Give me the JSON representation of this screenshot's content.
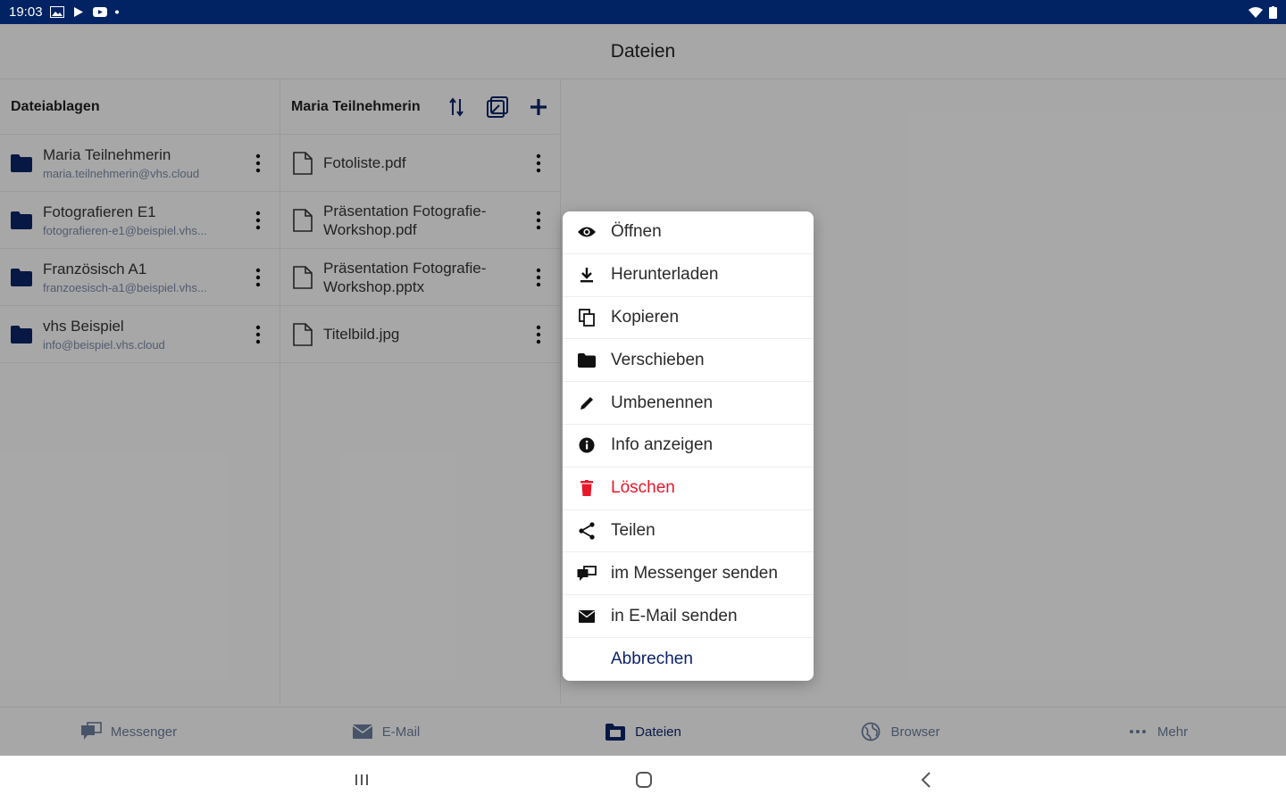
{
  "status_bar": {
    "time": "19:03"
  },
  "app": {
    "title": "Dateien",
    "colors": {
      "navy": "#0d2468",
      "danger": "#e8172a",
      "statusbar": "#012363"
    }
  },
  "stores": {
    "header": "Dateiablagen",
    "items": [
      {
        "name": "Maria Teilnehmerin",
        "email": "maria.teilnehmerin@vhs.cloud"
      },
      {
        "name": "Fotografieren E1",
        "email": "fotografieren-e1@beispiel.vhs..."
      },
      {
        "name": "Französisch A1",
        "email": "franzoesisch-a1@beispiel.vhs..."
      },
      {
        "name": "vhs Beispiel",
        "email": "info@beispiel.vhs.cloud"
      }
    ]
  },
  "files": {
    "header": "Maria Teilnehmerin",
    "items": [
      {
        "name": "Fotoliste.pdf"
      },
      {
        "name": "Präsentation Fotografie-Workshop.pdf"
      },
      {
        "name": "Präsentation Fotografie-Workshop.pptx"
      },
      {
        "name": "Titelbild.jpg"
      }
    ]
  },
  "menu": {
    "items": [
      {
        "label": "Öffnen",
        "icon": "eye-icon"
      },
      {
        "label": "Herunterladen",
        "icon": "download-icon"
      },
      {
        "label": "Kopieren",
        "icon": "copy-icon"
      },
      {
        "label": "Verschieben",
        "icon": "folder-icon"
      },
      {
        "label": "Umbenennen",
        "icon": "pencil-icon"
      },
      {
        "label": "Info anzeigen",
        "icon": "info-icon"
      },
      {
        "label": "Löschen",
        "icon": "trash-icon"
      },
      {
        "label": "Teilen",
        "icon": "share-icon"
      },
      {
        "label": "im Messenger senden",
        "icon": "messenger-icon"
      },
      {
        "label": "in E-Mail senden",
        "icon": "mail-icon"
      },
      {
        "label": "Abbrechen",
        "icon": ""
      }
    ]
  },
  "bottom_nav": {
    "items": [
      {
        "label": "Messenger",
        "icon": "messenger-icon"
      },
      {
        "label": "E-Mail",
        "icon": "mail-icon"
      },
      {
        "label": "Dateien",
        "icon": "files-icon"
      },
      {
        "label": "Browser",
        "icon": "globe-icon"
      },
      {
        "label": "Mehr",
        "icon": "more-icon"
      }
    ]
  }
}
